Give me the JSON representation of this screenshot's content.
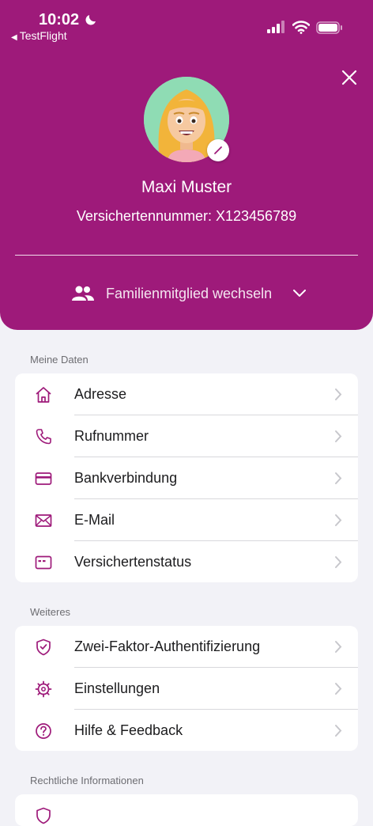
{
  "status_bar": {
    "time": "10:02",
    "back_app": "TestFlight"
  },
  "profile": {
    "name": "Maxi Muster",
    "insurance_number": "Versichertennummer: X123456789",
    "family_switch_label": "Familienmitglied wechseln"
  },
  "sections": [
    {
      "title": "Meine Daten",
      "items": [
        {
          "label": "Adresse",
          "icon": "house-icon"
        },
        {
          "label": "Rufnummer",
          "icon": "phone-icon"
        },
        {
          "label": "Bankverbindung",
          "icon": "credit-card-icon"
        },
        {
          "label": "E-Mail",
          "icon": "envelope-icon"
        },
        {
          "label": "Versichertenstatus",
          "icon": "id-card-icon"
        }
      ]
    },
    {
      "title": "Weiteres",
      "items": [
        {
          "label": "Zwei-Faktor-Authentifizierung",
          "icon": "shield-check-icon"
        },
        {
          "label": "Einstellungen",
          "icon": "gear-icon"
        },
        {
          "label": "Hilfe & Feedback",
          "icon": "question-circle-icon"
        }
      ]
    },
    {
      "title": "Rechtliche Informationen",
      "items": []
    }
  ],
  "colors": {
    "brand": "#9e1a7a",
    "background": "#f2f2f7",
    "icon": "#9e1a7a",
    "chevron": "#c7c7cc"
  }
}
